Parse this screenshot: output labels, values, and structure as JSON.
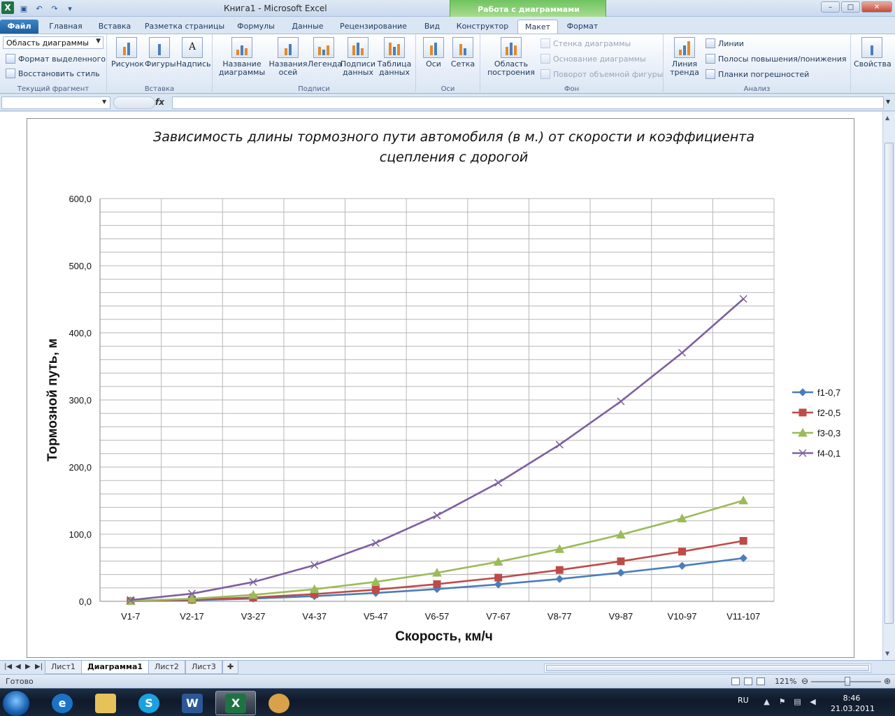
{
  "app": {
    "title": "Книга1 - Microsoft Excel",
    "context_title": "Работа с диаграммами"
  },
  "tabs": [
    {
      "label": "Файл"
    },
    {
      "label": "Главная"
    },
    {
      "label": "Вставка"
    },
    {
      "label": "Разметка страницы"
    },
    {
      "label": "Формулы"
    },
    {
      "label": "Данные"
    },
    {
      "label": "Рецензирование"
    },
    {
      "label": "Вид"
    },
    {
      "label": "Конструктор"
    },
    {
      "label": "Макет"
    },
    {
      "label": "Формат"
    }
  ],
  "ribbon": {
    "current": {
      "selector_value": "Область диаграммы",
      "format_selection": "Формат выделенного",
      "reset_style": "Восстановить стиль",
      "label": "Текущий фрагмент"
    },
    "insert": {
      "picture": "Рисунок",
      "shapes": "Фигуры",
      "textbox": "Надпись",
      "label": "Вставка"
    },
    "labels": {
      "chart_title_1": "Название",
      "chart_title_2": "диаграммы",
      "axis_titles_1": "Названия",
      "axis_titles_2": "осей",
      "legend": "Легенда",
      "data_labels_1": "Подписи",
      "data_labels_2": "данных",
      "data_table_1": "Таблица",
      "data_table_2": "данных",
      "label": "Подписи"
    },
    "axes": {
      "axes": "Оси",
      "grid": "Сетка",
      "label": "Оси"
    },
    "background": {
      "plot_area_1": "Область",
      "plot_area_2": "построения",
      "wall": "Стенка диаграммы",
      "floor": "Основание диаграммы",
      "rotation": "Поворот объемной фигуры",
      "label": "Фон"
    },
    "analysis": {
      "trend_1": "Линия",
      "trend_2": "тренда",
      "lines": "Линии",
      "updown": "Полосы повышения/понижения",
      "errorbars": "Планки погрешностей",
      "label": "Анализ"
    },
    "properties": {
      "label": "Свойства"
    }
  },
  "formula_bar": {
    "fx": "fx",
    "namebox": "",
    "content": ""
  },
  "chart_data": {
    "type": "line",
    "title_line1": "Зависимость длины тормозного пути автомобиля (в м.) от скорости и коэффициента",
    "title_line2": "сцепления с дорогой",
    "xlabel": "Скорость, км/ч",
    "ylabel": "Тормозной путь, м",
    "categories": [
      "V1-7",
      "V2-17",
      "V3-27",
      "V4-37",
      "V5-47",
      "V6-57",
      "V7-67",
      "V8-77",
      "V9-87",
      "V10-97",
      "V11-107"
    ],
    "ylim": [
      0,
      600
    ],
    "yticks": [
      "0,0",
      "100,0",
      "200,0",
      "300,0",
      "400,0",
      "500,0",
      "600,0"
    ],
    "grid": true,
    "legend_position": "right",
    "series": [
      {
        "name": "f1-0,7",
        "color": "#4a7ebb",
        "marker": "diamond",
        "values": [
          0.3,
          1.6,
          4.1,
          7.7,
          12.4,
          18.3,
          25.2,
          33.3,
          42.6,
          52.9,
          64.3
        ]
      },
      {
        "name": "f2-0,5",
        "color": "#be4b48",
        "marker": "square",
        "values": [
          0.4,
          2.3,
          5.7,
          10.8,
          17.4,
          25.6,
          35.3,
          46.7,
          59.6,
          74.1,
          90.1
        ]
      },
      {
        "name": "f3-0,3",
        "color": "#9bbb59",
        "marker": "triangle",
        "values": [
          0.6,
          3.8,
          9.6,
          18.0,
          29.0,
          42.6,
          58.9,
          77.8,
          99.3,
          123.5,
          150.2
        ]
      },
      {
        "name": "f4-0,1",
        "color": "#7d60a0",
        "marker": "x",
        "values": [
          1.9,
          11.4,
          28.7,
          53.9,
          87.0,
          127.9,
          176.7,
          233.4,
          297.9,
          370.3,
          450.5
        ]
      }
    ]
  },
  "sheets": {
    "tabs": [
      "Лист1",
      "Диаграмма1",
      "Лист2",
      "Лист3"
    ],
    "active": "Диаграмма1"
  },
  "status": {
    "ready": "Готово",
    "zoom": "121%"
  },
  "taskbar": {
    "lang": "RU",
    "time": "8:46",
    "date": "21.03.2011"
  }
}
